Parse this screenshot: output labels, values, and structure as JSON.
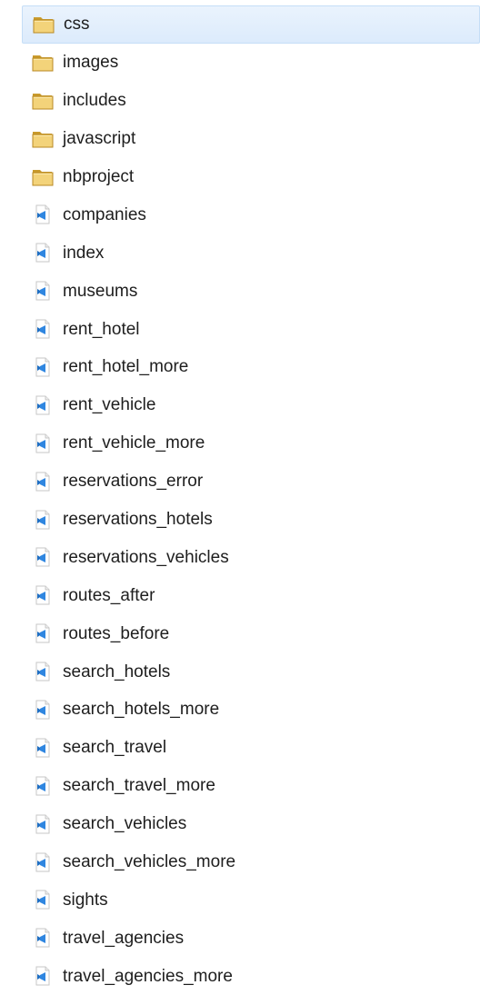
{
  "explorer": {
    "items": [
      {
        "name": "css",
        "type": "folder",
        "selected": true
      },
      {
        "name": "images",
        "type": "folder"
      },
      {
        "name": "includes",
        "type": "folder"
      },
      {
        "name": "javascript",
        "type": "folder"
      },
      {
        "name": "nbproject",
        "type": "folder"
      },
      {
        "name": "companies",
        "type": "file"
      },
      {
        "name": "index",
        "type": "file"
      },
      {
        "name": "museums",
        "type": "file"
      },
      {
        "name": "rent_hotel",
        "type": "file"
      },
      {
        "name": "rent_hotel_more",
        "type": "file"
      },
      {
        "name": "rent_vehicle",
        "type": "file"
      },
      {
        "name": "rent_vehicle_more",
        "type": "file"
      },
      {
        "name": "reservations_error",
        "type": "file"
      },
      {
        "name": "reservations_hotels",
        "type": "file"
      },
      {
        "name": "reservations_vehicles",
        "type": "file"
      },
      {
        "name": "routes_after",
        "type": "file"
      },
      {
        "name": "routes_before",
        "type": "file"
      },
      {
        "name": "search_hotels",
        "type": "file"
      },
      {
        "name": "search_hotels_more",
        "type": "file"
      },
      {
        "name": "search_travel",
        "type": "file"
      },
      {
        "name": "search_travel_more",
        "type": "file"
      },
      {
        "name": "search_vehicles",
        "type": "file"
      },
      {
        "name": "search_vehicles_more",
        "type": "file"
      },
      {
        "name": "sights",
        "type": "file"
      },
      {
        "name": "travel_agencies",
        "type": "file"
      },
      {
        "name": "travel_agencies_more",
        "type": "file"
      }
    ],
    "icons": {
      "folder": "folder-icon",
      "file": "netbeans-file-icon"
    },
    "colors": {
      "selection_bg": "#dcebfc",
      "selection_border": "#c5def7",
      "folder": "#e8c35a",
      "file_badge": "#1f6fc4"
    }
  }
}
